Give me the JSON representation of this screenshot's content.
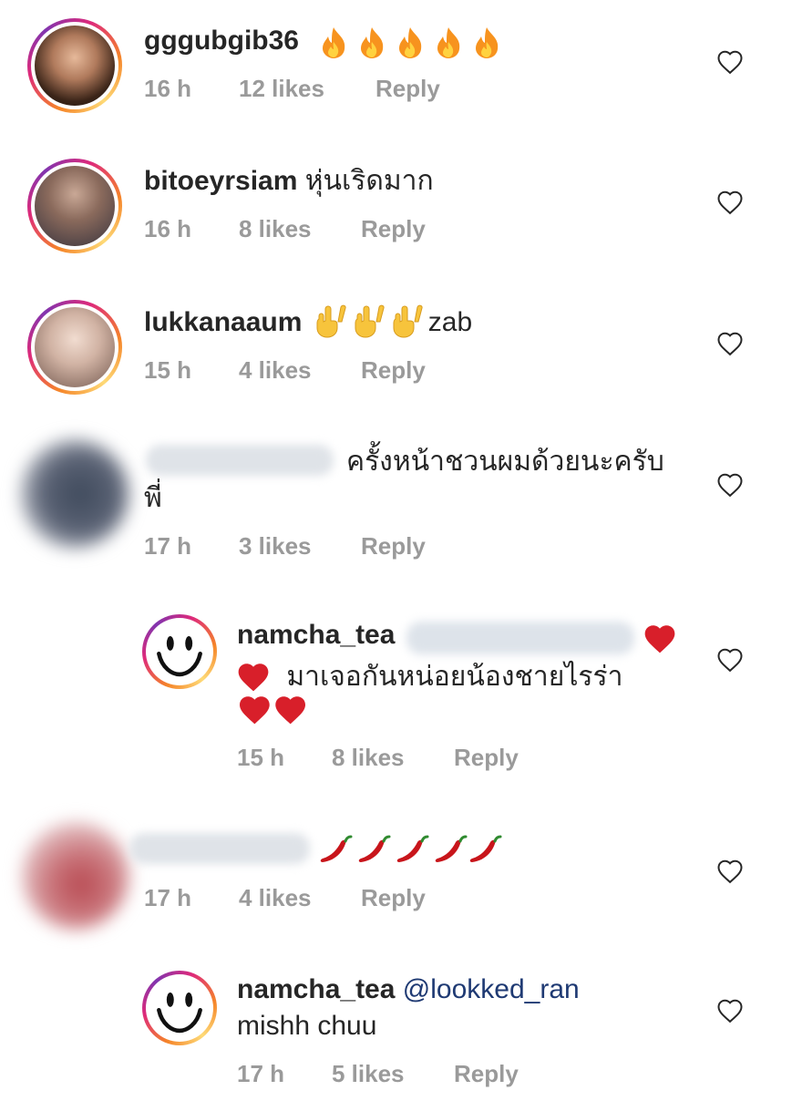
{
  "comments": [
    {
      "username": "gggubgib36",
      "text": "",
      "time": "16 h",
      "likes": "12 likes",
      "reply": "Reply",
      "emoji": "fire",
      "emoji_count": 5
    },
    {
      "username": "bitoeyrsiam",
      "text": "หุ่นเริดมาก",
      "time": "16 h",
      "likes": "8 likes",
      "reply": "Reply"
    },
    {
      "username": "lukkanaaum",
      "text": "zab",
      "time": "15 h",
      "likes": "4 likes",
      "reply": "Reply",
      "emoji": "rock-hand",
      "emoji_count": 3
    },
    {
      "username": "",
      "text": "ครั้งหน้าชวนผมด้วยนะครับ",
      "text2": "พี่",
      "time": "17 h",
      "likes": "3 likes",
      "reply": "Reply"
    },
    {
      "username": "namcha_tea",
      "text": "มาเจอกันหน่อยน้องชายไรร่า",
      "time": "15 h",
      "likes": "8 likes",
      "reply": "Reply",
      "emoji": "red-heart"
    },
    {
      "username": "",
      "text": "",
      "time": "17 h",
      "likes": "4 likes",
      "reply": "Reply",
      "emoji": "chili-pepper",
      "emoji_count": 5
    },
    {
      "username": "namcha_tea",
      "mention": "@lookked_ran",
      "text": "mishh chuu",
      "time": "17 h",
      "likes": "5 likes",
      "reply": "Reply"
    }
  ],
  "colors": {
    "username": "#262626",
    "meta": "#9a9a9a",
    "mention": "#1f3a73",
    "heart_outline": "#262626",
    "red_heart": "#d81f2a",
    "fire": "#f7931e",
    "chili": "#c8151b"
  },
  "icons": {
    "like": "heart-outline-icon",
    "avatar_smiley": "smiley-face-icon"
  }
}
